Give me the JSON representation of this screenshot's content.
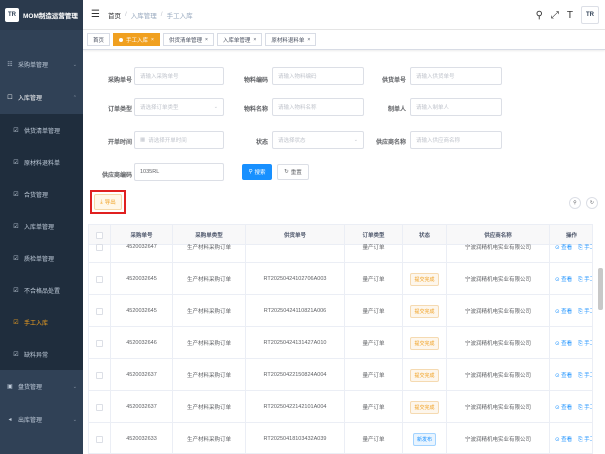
{
  "sidebar": {
    "logo_text": "TR",
    "app_title": "MOM制造运营管理",
    "items": [
      {
        "label": "采购单管理",
        "type": "top",
        "chevron": "⌄"
      },
      {
        "label": "入库管理",
        "type": "open",
        "chevron": "⌃"
      },
      {
        "label": "供货清单管理",
        "type": "sub"
      },
      {
        "label": "原材料退料单",
        "type": "sub"
      },
      {
        "label": "合货管理",
        "type": "sub"
      },
      {
        "label": "入库单管理",
        "type": "sub"
      },
      {
        "label": "质检单管理",
        "type": "sub"
      },
      {
        "label": "不合格品处置",
        "type": "sub"
      },
      {
        "label": "手工入库",
        "type": "sub",
        "active": true
      },
      {
        "label": "缺料异常",
        "type": "sub"
      },
      {
        "label": "盘货管理",
        "type": "top",
        "chevron": "⌄"
      },
      {
        "label": "出库管理",
        "type": "top",
        "chevron": "⌄"
      }
    ]
  },
  "navbar": {
    "breadcrumb": [
      "首页",
      "入库管理",
      "手工入库"
    ],
    "icons": [
      "search-icon",
      "fullscreen-icon",
      "font-size-icon",
      "avatar"
    ],
    "avatar_text": "TR"
  },
  "tags": [
    {
      "label": "首页",
      "active": false
    },
    {
      "label": "手工入库",
      "active": true
    },
    {
      "label": "供货清单管理",
      "active": false
    },
    {
      "label": "入库单管理",
      "active": false
    },
    {
      "label": "原材料退料单",
      "active": false
    }
  ],
  "form": {
    "purchase_no": {
      "label": "采购单号",
      "placeholder": "请输入采购单号"
    },
    "material_code": {
      "label": "物料编码",
      "placeholder": "请输入物料编码"
    },
    "supplier_no": {
      "label": "供货单号",
      "placeholder": "请输入供货单号"
    },
    "order_type": {
      "label": "订单类型",
      "placeholder": "请选择订单类型"
    },
    "material_name": {
      "label": "物料名称",
      "placeholder": "请输入物料名称"
    },
    "creator": {
      "label": "制单人",
      "placeholder": "请输入制单人"
    },
    "open_time": {
      "label": "开单时间",
      "placeholder": "请选择开单时间"
    },
    "status": {
      "label": "状态",
      "placeholder": "请选择状态"
    },
    "supplier_name": {
      "label": "供应商名称",
      "placeholder": "请输入供应商名称"
    },
    "supplier_code": {
      "label": "供应商编码",
      "value": "1035RL"
    },
    "search_button": "搜索",
    "reset_button": "重置",
    "export_button": "导出"
  },
  "table": {
    "headers": [
      "",
      "采购单号",
      "采购单类型",
      "供货单号",
      "订单类型",
      "状态",
      "供应商名称",
      "操作"
    ],
    "rows": [
      {
        "po": "4520032647",
        "po_type": "生产材料采购订单",
        "supply_no": "",
        "order_type": "量产订单",
        "status": "",
        "supplier": "宁波润精机电实业有限公司",
        "partial": true
      },
      {
        "po": "4520032645",
        "po_type": "生产材料采购订单",
        "supply_no": "RT20250424102706A003",
        "order_type": "量产订单",
        "status": "提交完成",
        "supplier": "宁波润精机电实业有限公司"
      },
      {
        "po": "4520032645",
        "po_type": "生产材料采购订单",
        "supply_no": "RT20250424110821A006",
        "order_type": "量产订单",
        "status": "提交完成",
        "supplier": "宁波润精机电实业有限公司"
      },
      {
        "po": "4520032646",
        "po_type": "生产材料采购订单",
        "supply_no": "RT20250424131427A010",
        "order_type": "量产订单",
        "status": "提交完成",
        "supplier": "宁波润精机电实业有限公司"
      },
      {
        "po": "4520032637",
        "po_type": "生产材料采购订单",
        "supply_no": "RT20250422150824A004",
        "order_type": "量产订单",
        "status": "提交完成",
        "supplier": "宁波润精机电实业有限公司"
      },
      {
        "po": "4520032637",
        "po_type": "生产材料采购订单",
        "supply_no": "RT20250422142101A004",
        "order_type": "量产订单",
        "status": "提交完成",
        "supplier": "宁波润精机电实业有限公司"
      },
      {
        "po": "4520032633",
        "po_type": "生产材料采购订单",
        "supply_no": "RT20250418103432A039",
        "order_type": "量产订单",
        "status": "新发布",
        "supplier": "宁波润精机电实业有限公司"
      }
    ],
    "op_view": "查看",
    "op_manual": "手工入库"
  },
  "colors": {
    "sidebar": "#304156",
    "accent": "#f0a020",
    "primary": "#1890ff"
  }
}
